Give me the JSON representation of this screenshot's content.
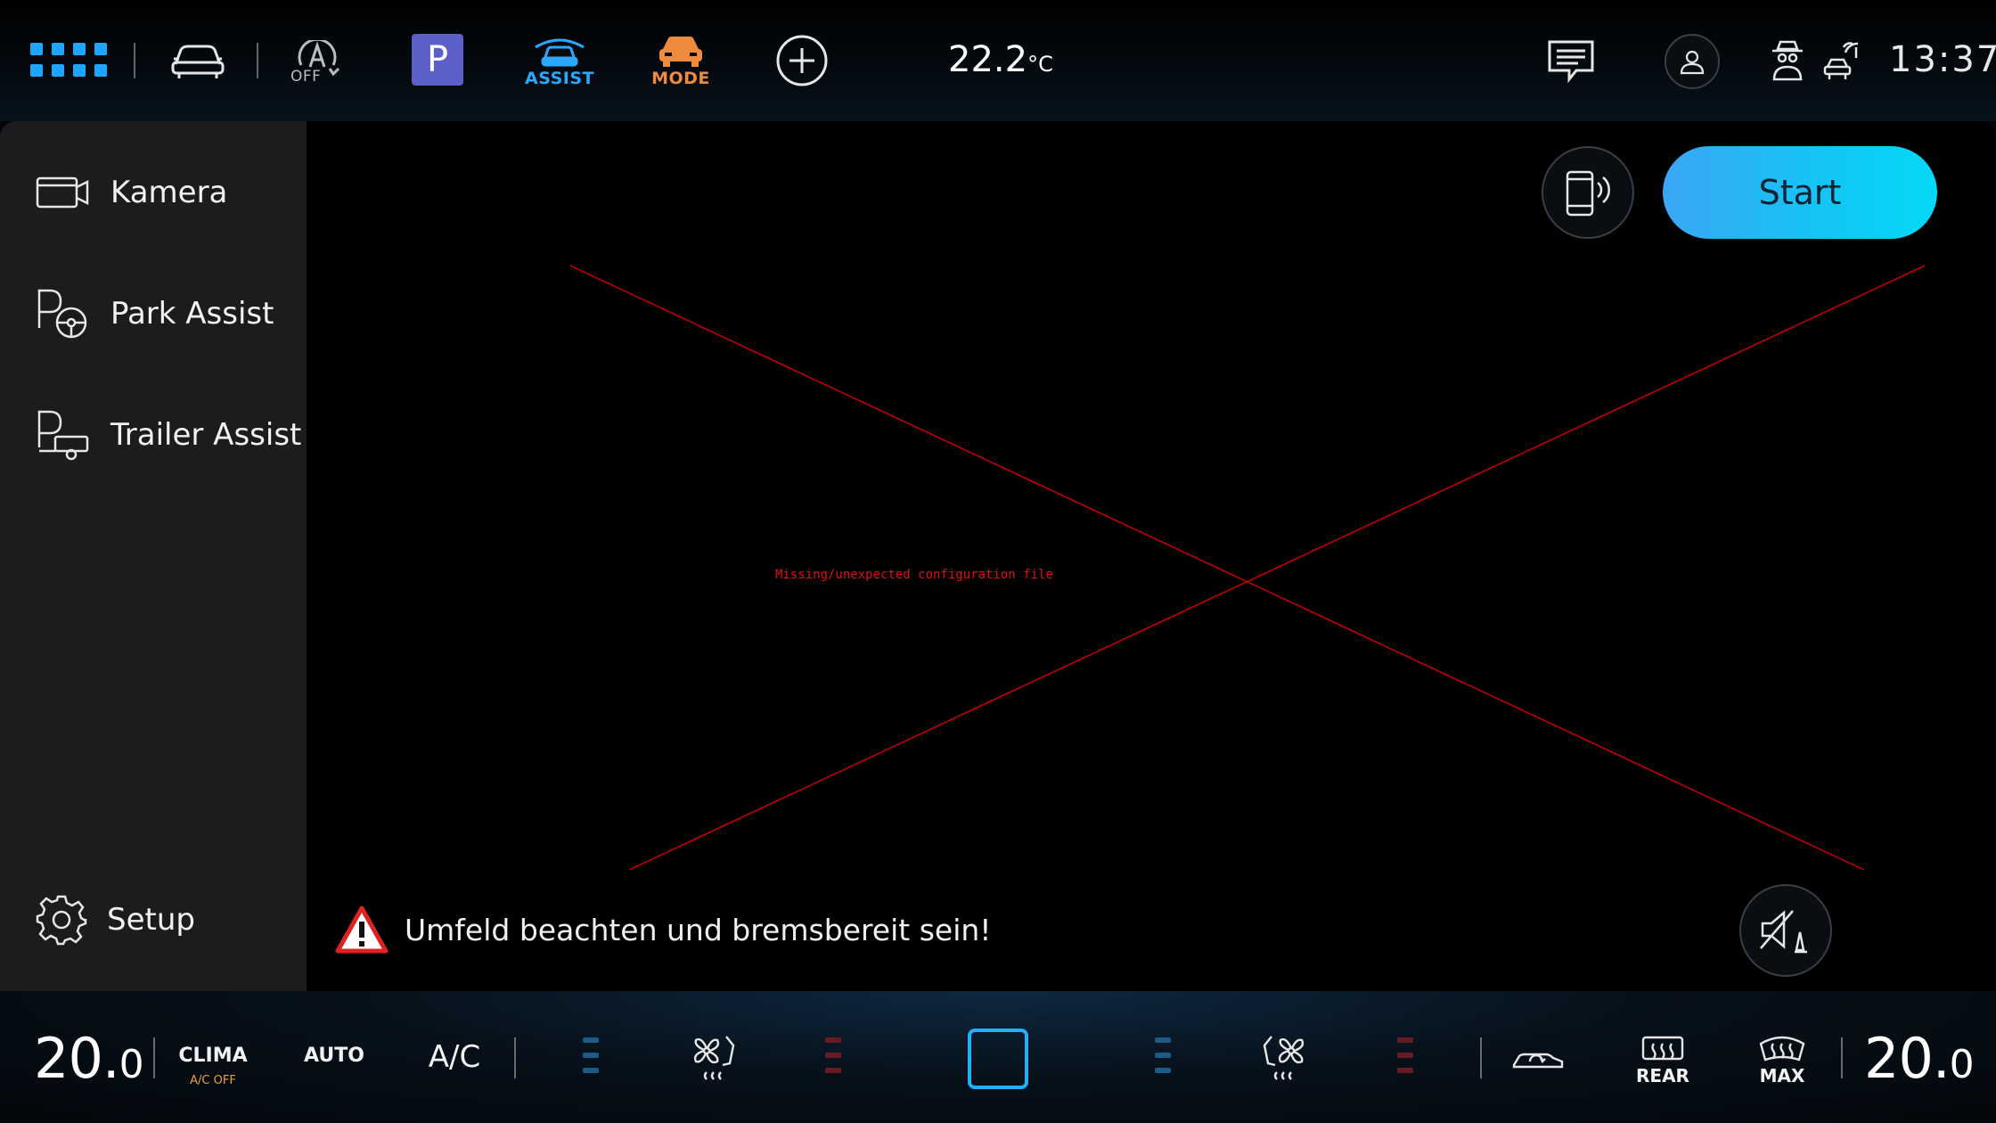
{
  "topbar": {
    "assist_drive_label": "OFF",
    "park_label": "P",
    "assist_label": "ASSIST",
    "mode_label": "MODE",
    "temperature_value": "22.2",
    "temperature_unit": "°C",
    "clock": "13:37"
  },
  "sidebar": {
    "items": [
      {
        "label": "Kamera",
        "icon": "camera-icon"
      },
      {
        "label": "Park Assist",
        "icon": "park-assist-icon"
      },
      {
        "label": "Trailer Assist",
        "icon": "trailer-assist-icon"
      }
    ],
    "setup_label": "Setup"
  },
  "main": {
    "start_label": "Start",
    "error_text": "Missing/unexpected configuration file",
    "warning_text": "Umfeld beachten und bremsbereit sein!"
  },
  "climate": {
    "left_temp_int": "20.",
    "left_temp_dec": "0",
    "clima_label": "CLIMA",
    "ac_off_label": "A/C OFF",
    "auto_label": "AUTO",
    "ac_label": "A/C",
    "rear_label": "REAR",
    "max_label": "MAX",
    "right_temp_int": "20.",
    "right_temp_dec": "0"
  },
  "colors": {
    "accent_blue": "#1ea6ff",
    "park_purple": "#5b5fc7",
    "mode_orange": "#f08a3c",
    "start_gradient": [
      "#3ba6f5",
      "#05d9f8"
    ],
    "error_red": "#d11111",
    "ac_off_orange": "#f0a030"
  }
}
